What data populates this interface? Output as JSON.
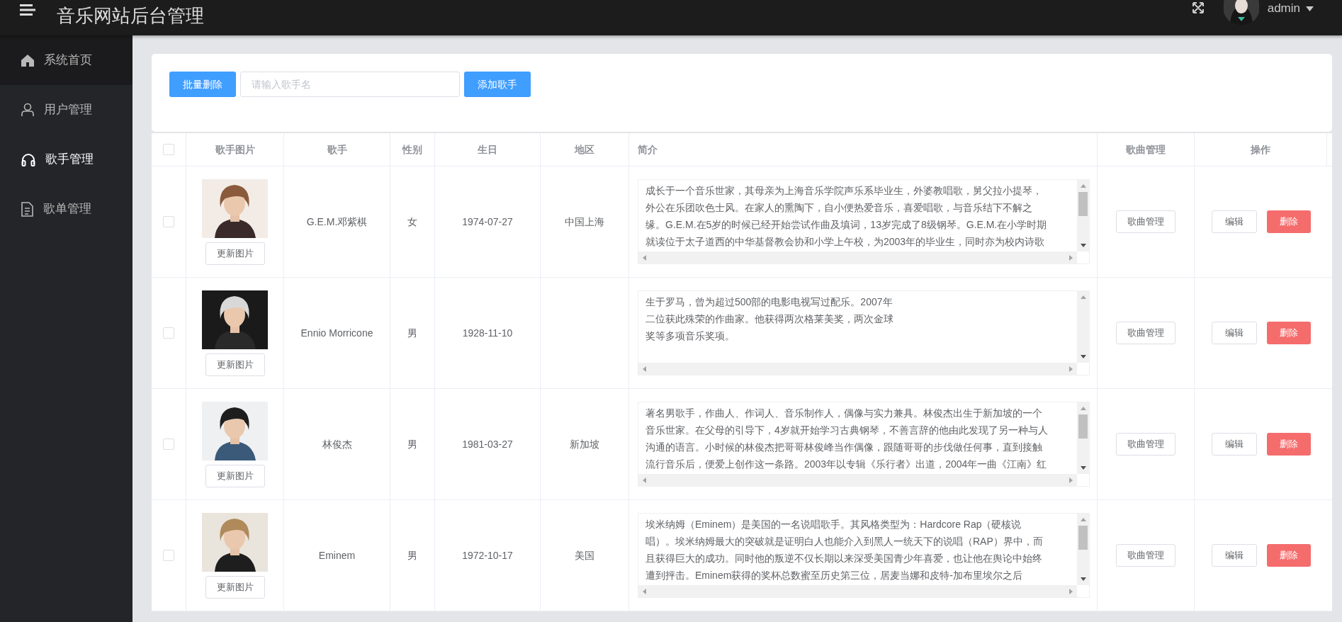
{
  "header": {
    "title": "音乐网站后台管理",
    "user": "admin"
  },
  "sidebar": {
    "items": [
      {
        "label": "系统首页",
        "kind": "home",
        "selected": false
      },
      {
        "label": "用户管理",
        "kind": "user",
        "selected": false
      },
      {
        "label": "歌手管理",
        "kind": "headphones",
        "selected": true
      },
      {
        "label": "歌单管理",
        "kind": "document",
        "selected": false
      }
    ]
  },
  "toolbar": {
    "delete_button": "批量删除",
    "search": {
      "placeholder": "请输入歌手名"
    },
    "add_button": "添加歌手"
  },
  "table": {
    "columns": [
      "歌手图片",
      "歌手",
      "性别",
      "生日",
      "地区",
      "简介",
      "歌曲管理",
      "操作"
    ],
    "header_checked": false,
    "rows": [
      {
        "checked": false,
        "photo": {
          "kind": "picture"
        },
        "update_button": "更新图片",
        "name": "G.E.M.邓紫棋",
        "sex": "女",
        "birthday": "1974-07-27",
        "region": "中国上海",
        "intro": [
          "成长于一个音乐世家，其母亲为上海音乐学院声乐系毕业生，外婆教唱歌，舅父拉小提琴，",
          "外公在乐团吹色士风。在家人的熏陶下，自小便热爱音乐，喜爱唱歌，与音乐结下不解之",
          "缘。G.E.M.在5岁的时候已经开始尝试作曲及填词，13岁完成了8级钢琴。G.E.M.在小学时期",
          "就读位于太子道西的中华基督教会协和小学上午校，为2003年的毕业生，同时亦为校内诗歌"
        ],
        "songs_button": "歌曲管理",
        "edit_button": "编辑",
        "delete_button": "删除"
      },
      {
        "checked": false,
        "photo": {
          "kind": "picture"
        },
        "update_button": "更新图片",
        "name": "Ennio Morricone",
        "sex": "男",
        "birthday": "1928-11-10",
        "intro": [
          "生于罗马，曾为超过500部的电影电视写过配乐。2007年",
          "二位获此殊荣的作曲家。他获得两次格莱美奖，两次金球",
          "奖等多项音乐奖项。"
        ],
        "songs_button": "歌曲管理",
        "edit_button": "编辑",
        "delete_button": "删除"
      },
      {
        "checked": false,
        "photo": {
          "kind": "picture"
        },
        "update_button": "更新图片",
        "name": "林俊杰",
        "sex": "男",
        "birthday": "1981-03-27",
        "region": "新加坡",
        "intro": [
          "著名男歌手，作曲人、作词人、音乐制作人，偶像与实力兼具。林俊杰出生于新加坡的一个",
          "音乐世家。在父母的引导下，4岁就开始学习古典钢琴，不善言辞的他由此发现了另一种与人",
          "沟通的语言。小时候的林俊杰把哥哥林俊峰当作偶像，跟随哥哥的步伐做任何事，直到接触",
          "流行音乐后，便爱上创作这一条路。2003年以专辑《乐行者》出道，2004年一曲《江南》红"
        ],
        "songs_button": "歌曲管理",
        "edit_button": "编辑",
        "delete_button": "删除"
      },
      {
        "checked": false,
        "photo": {
          "kind": "picture"
        },
        "update_button": "更新图片",
        "name": "Eminem",
        "sex": "男",
        "birthday": "1972-10-17",
        "region": "美国",
        "intro": [
          "埃米纳姆（Eminem）是美国的一名说唱歌手。其风格类型为：Hardcore Rap（硬核说",
          "唱）。埃米纳姆最大的突破就是证明白人也能介入到黑人一统天下的说唱（RAP）界中，而",
          "且获得巨大的成功。同时他的叛逆不仅长期以来深受美国青少年喜爱，也让他在舆论中始终",
          "遭到抨击。Eminem获得的奖杯总数蜜至历史第三位，居麦当娜和皮特-加布里埃尔之后"
        ],
        "songs_button": "歌曲管理",
        "edit_button": "编辑",
        "delete_button": "删除"
      }
    ]
  }
}
